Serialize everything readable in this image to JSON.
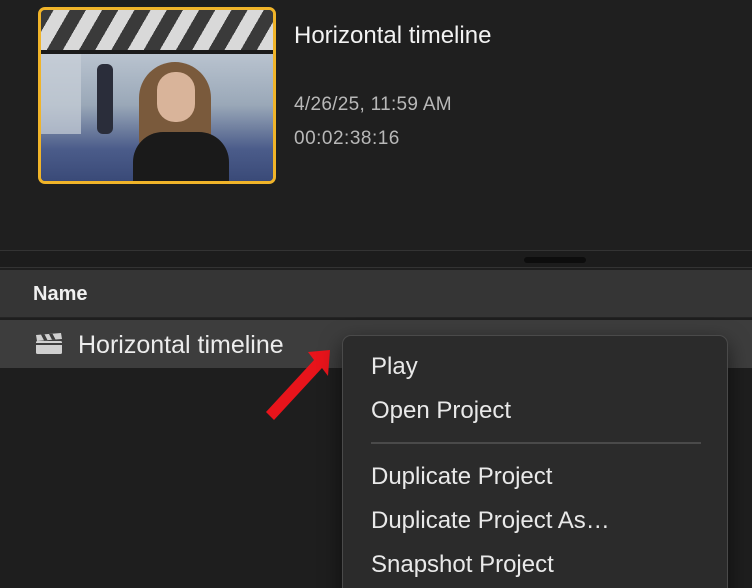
{
  "project": {
    "title": "Horizontal timeline",
    "date": "4/26/25, 11:59 AM",
    "duration": "00:02:38:16"
  },
  "list": {
    "header": {
      "name_label": "Name"
    },
    "rows": [
      {
        "label": "Horizontal timeline",
        "icon": "clapperboard-icon"
      }
    ]
  },
  "context_menu": {
    "items": [
      {
        "label": "Play"
      },
      {
        "label": "Open Project"
      },
      {
        "label": "Duplicate Project"
      },
      {
        "label": "Duplicate Project As…"
      },
      {
        "label": "Snapshot Project"
      }
    ]
  },
  "colors": {
    "thumbnail_border": "#f0b429",
    "arrow": "#e8141b",
    "selected_row": "#3d3d3d"
  }
}
